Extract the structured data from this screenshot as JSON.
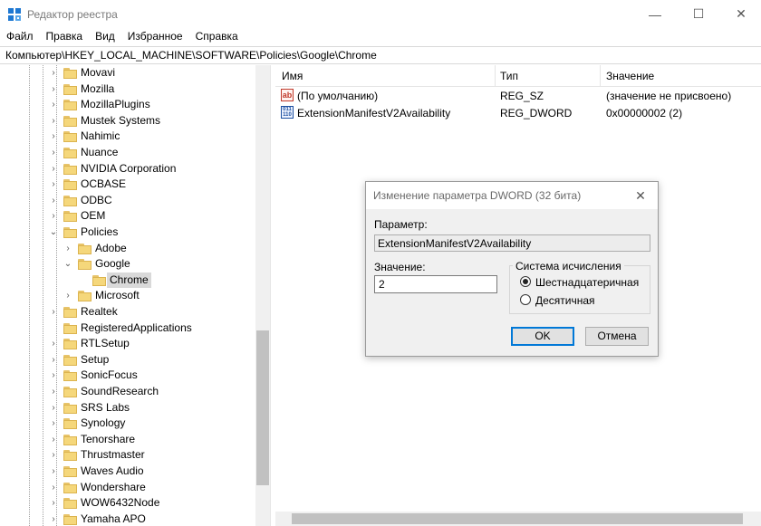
{
  "window": {
    "title": "Редактор реестра",
    "controls": {
      "minimize": "—",
      "maximize": "☐",
      "close": "✕"
    }
  },
  "menu": [
    "Файл",
    "Правка",
    "Вид",
    "Избранное",
    "Справка"
  ],
  "address": "Компьютер\\HKEY_LOCAL_MACHINE\\SOFTWARE\\Policies\\Google\\Chrome",
  "tree": {
    "items": [
      {
        "label": "Movavi",
        "level": 0,
        "expander": "›"
      },
      {
        "label": "Mozilla",
        "level": 0,
        "expander": "›"
      },
      {
        "label": "MozillaPlugins",
        "level": 0,
        "expander": "›"
      },
      {
        "label": "Mustek Systems",
        "level": 0,
        "expander": "›"
      },
      {
        "label": "Nahimic",
        "level": 0,
        "expander": "›"
      },
      {
        "label": "Nuance",
        "level": 0,
        "expander": "›"
      },
      {
        "label": "NVIDIA Corporation",
        "level": 0,
        "expander": "›"
      },
      {
        "label": "OCBASE",
        "level": 0,
        "expander": "›"
      },
      {
        "label": "ODBC",
        "level": 0,
        "expander": "›"
      },
      {
        "label": "OEM",
        "level": 0,
        "expander": "›"
      },
      {
        "label": "Policies",
        "level": 0,
        "expander": "⌄"
      },
      {
        "label": "Adobe",
        "level": 1,
        "expander": "›"
      },
      {
        "label": "Google",
        "level": 1,
        "expander": "⌄"
      },
      {
        "label": "Chrome",
        "level": 2,
        "expander": "",
        "selected": true
      },
      {
        "label": "Microsoft",
        "level": 1,
        "expander": "›"
      },
      {
        "label": "Realtek",
        "level": 0,
        "expander": "›"
      },
      {
        "label": "RegisteredApplications",
        "level": 0,
        "expander": ""
      },
      {
        "label": "RTLSetup",
        "level": 0,
        "expander": "›"
      },
      {
        "label": "Setup",
        "level": 0,
        "expander": "›"
      },
      {
        "label": "SonicFocus",
        "level": 0,
        "expander": "›"
      },
      {
        "label": "SoundResearch",
        "level": 0,
        "expander": "›"
      },
      {
        "label": "SRS Labs",
        "level": 0,
        "expander": "›"
      },
      {
        "label": "Synology",
        "level": 0,
        "expander": "›"
      },
      {
        "label": "Tenorshare",
        "level": 0,
        "expander": "›"
      },
      {
        "label": "Thrustmaster",
        "level": 0,
        "expander": "›"
      },
      {
        "label": "Waves Audio",
        "level": 0,
        "expander": "›"
      },
      {
        "label": "Wondershare",
        "level": 0,
        "expander": "›"
      },
      {
        "label": "WOW6432Node",
        "level": 0,
        "expander": "›"
      },
      {
        "label": "Yamaha APO",
        "level": 0,
        "expander": "›"
      }
    ]
  },
  "list": {
    "columns": {
      "name": "Имя",
      "type": "Тип",
      "value": "Значение"
    },
    "rows": [
      {
        "icon": "string-value-icon",
        "name": "(По умолчанию)",
        "type": "REG_SZ",
        "value": "(значение не присвоено)"
      },
      {
        "icon": "dword-value-icon",
        "name": "ExtensionManifestV2Availability",
        "type": "REG_DWORD",
        "value": "0x00000002 (2)"
      }
    ]
  },
  "dialog": {
    "title": "Изменение параметра DWORD (32 бита)",
    "param_label": "Параметр:",
    "param_value": "ExtensionManifestV2Availability",
    "value_label": "Значение:",
    "value": "2",
    "base_group": "Система исчисления",
    "radio_hex": "Шестнадцатеричная",
    "radio_dec": "Десятичная",
    "ok": "OK",
    "cancel": "Отмена"
  }
}
